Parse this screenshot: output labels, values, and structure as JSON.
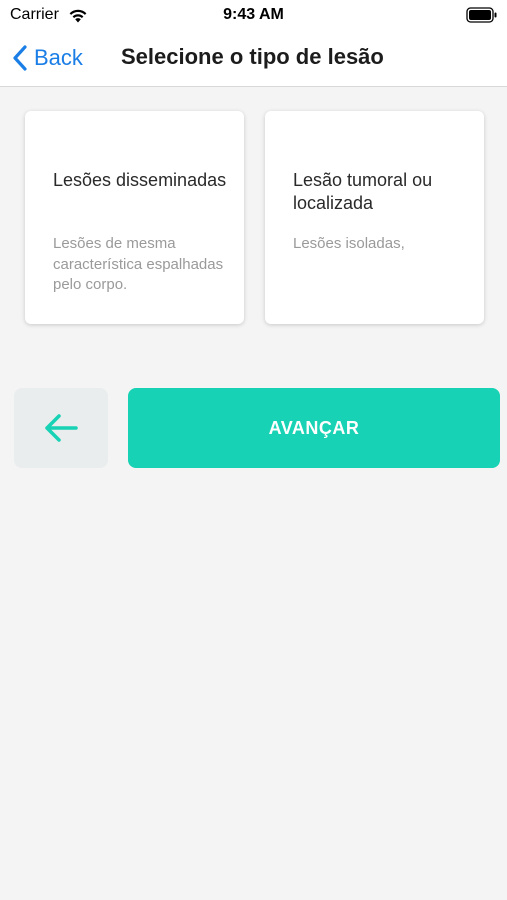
{
  "status_bar": {
    "carrier": "Carrier",
    "time": "9:43 AM",
    "wifi_icon": "wifi-icon",
    "battery_icon": "battery-icon"
  },
  "nav": {
    "back_label": "Back",
    "back_icon": "chevron-left-icon",
    "title": "Selecione o tipo de lesão"
  },
  "options": [
    {
      "title": "Lesões disseminadas",
      "description": "Lesões de mesma característica espalhadas pelo corpo."
    },
    {
      "title": "Lesão tumoral ou localizada",
      "description": "Lesões isoladas,"
    }
  ],
  "actions": {
    "back_icon": "arrow-left-icon",
    "advance_label": "AVANÇAR"
  },
  "colors": {
    "accent": "#17d2b4",
    "ios_blue": "#1a7ee6",
    "background": "#f4f4f4"
  }
}
